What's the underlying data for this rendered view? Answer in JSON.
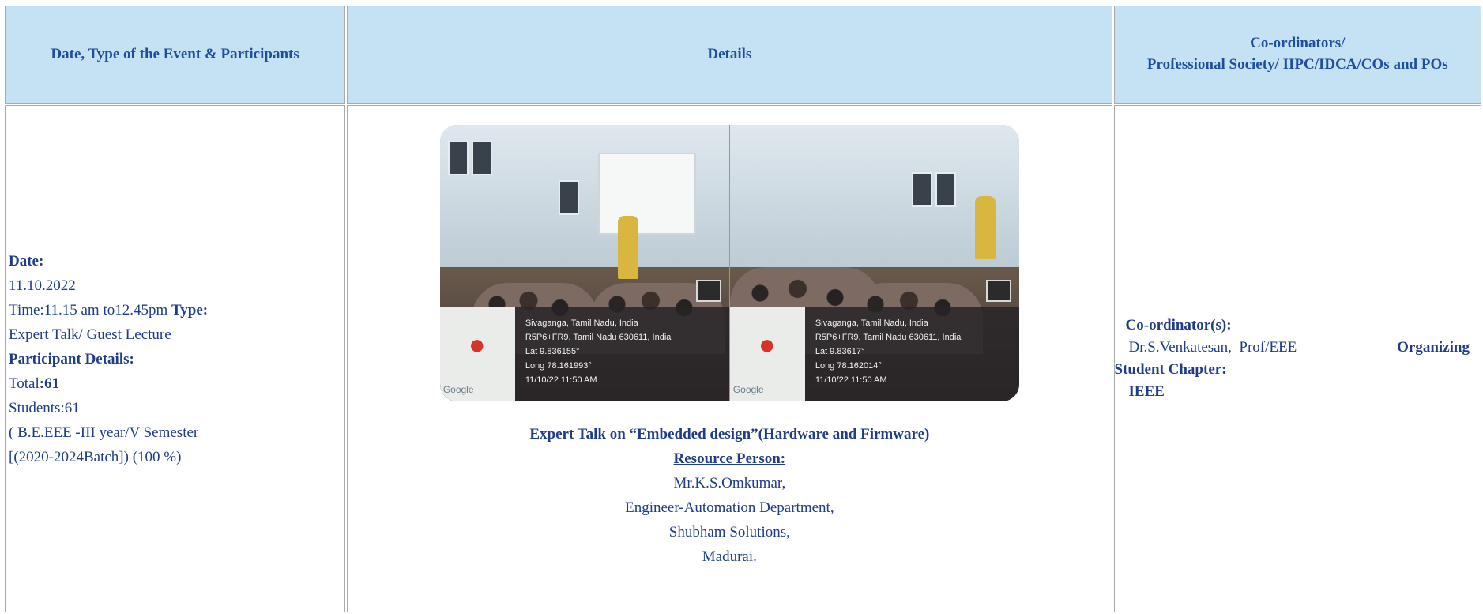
{
  "header": {
    "col1": "Date, Type of the Event & Participants",
    "col2": "Details",
    "col3_line1": "Co-ordinators/",
    "col3_line2": "Professional Society/ IIPC/IDCA/COs and POs"
  },
  "left": {
    "date_label": "Date:",
    "date_value": "11.10.2022",
    "time_text": "Time:11.15 am to12.45pm",
    "type_label": "Type:",
    "type_value": "Expert Talk/ Guest Lecture",
    "participants_label": "Participant Details:",
    "total_prefix": "Total",
    "total_value": ":61",
    "students": "Students:61",
    "class_line1": "( B.E.EEE -III year/V Semester",
    "class_line2": "[(2020-2024Batch]) (100 %)"
  },
  "photo": {
    "left": {
      "place": "Sivaganga, Tamil Nadu, India",
      "address": "R5P6+FR9, Tamil Nadu 630611, India",
      "lat": "Lat 9.836155°",
      "long": "Long 78.161993°",
      "datetime": "11/10/22 11:50 AM"
    },
    "right": {
      "place": "Sivaganga, Tamil Nadu, India",
      "address": "R5P6+FR9, Tamil Nadu 630611, India",
      "lat": "Lat 9.83617°",
      "long": "Long 78.162014°",
      "datetime": "11/10/22 11:50 AM"
    },
    "map_brand": "Google"
  },
  "details": {
    "title": "Expert Talk on “Embedded design”(Hardware and Firmware)",
    "resource_label": "Resource Person:",
    "name": "Mr.K.S.Omkumar,",
    "role": "Engineer-Automation Department,",
    "company": "Shubham Solutions,",
    "city": "Madurai."
  },
  "right": {
    "coordinator_label": "Co-ordinator(s):",
    "coordinator_name": "Dr.S.Venkatesan,",
    "coordinator_dept": "Prof/EEE",
    "organizing_label": "Organizing",
    "chapter_label": "Student Chapter:",
    "chapter_value": "IEEE"
  },
  "colors": {
    "header_bg": "#c5e2f5",
    "text": "#1f3d86",
    "border": "#a9a9a9"
  }
}
